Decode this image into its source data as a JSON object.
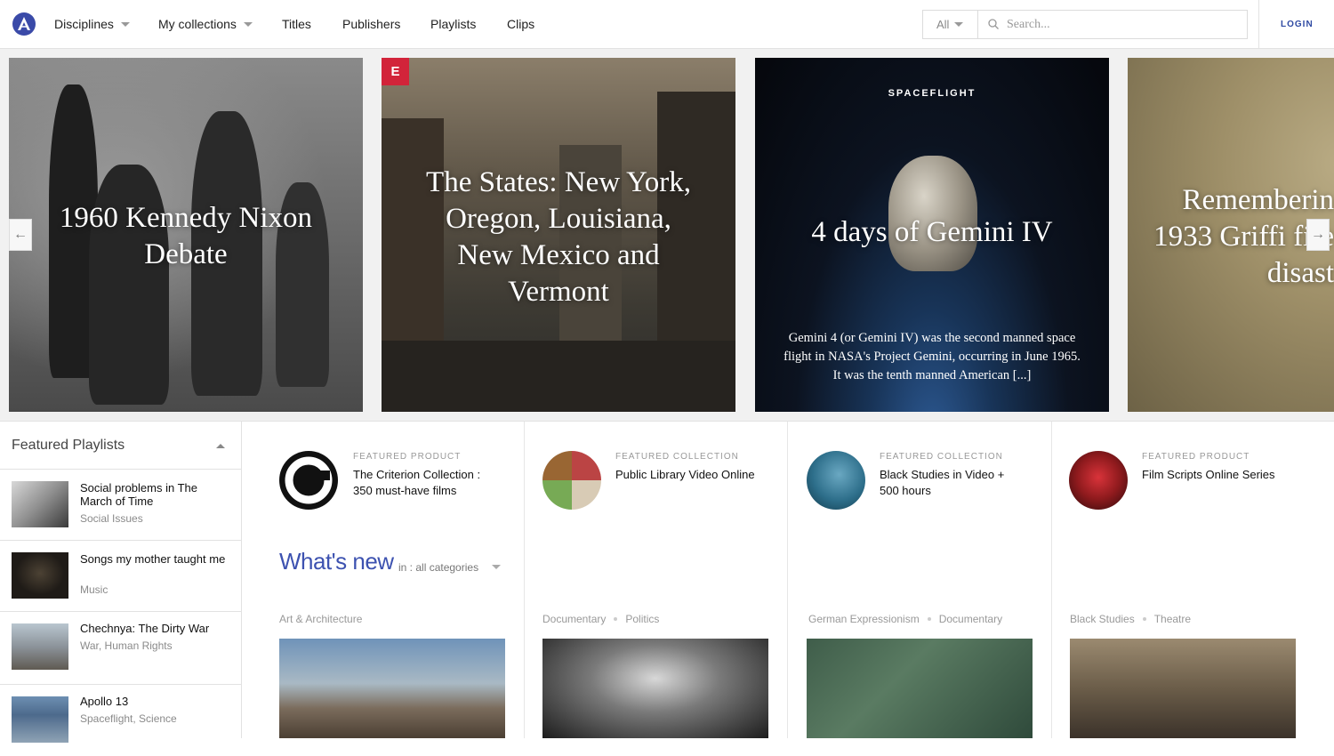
{
  "nav": {
    "items": [
      {
        "label": "Disciplines",
        "dropdown": true
      },
      {
        "label": "My collections",
        "dropdown": true
      },
      {
        "label": "Titles"
      },
      {
        "label": "Publishers"
      },
      {
        "label": "Playlists"
      },
      {
        "label": "Clips"
      }
    ],
    "search_scope": "All",
    "search_placeholder": "Search...",
    "login": "LOGIN",
    "accent": "#2f4aa3"
  },
  "hero": {
    "slides": [
      {
        "title": "1960 Kennedy Nixon Debate"
      },
      {
        "title": "The States: New York, Oregon, Louisiana, New Mexico and Vermont",
        "badge": "E",
        "badge_color": "#d2243a"
      },
      {
        "kicker": "SPACEFLIGHT",
        "title": "4 days of Gemini IV",
        "description": "Gemini 4 (or Gemini IV) was the second manned space flight in NASA's Project Gemini, occurring in June 1965. It was the tenth manned American [...]"
      },
      {
        "title": "Rememberin 1933 Griffi fire disast"
      }
    ],
    "prev_icon": "←",
    "next_icon": "→"
  },
  "sidebar": {
    "title": "Featured Playlists",
    "items": [
      {
        "title": "Social problems in The March of Time",
        "category": "Social Issues"
      },
      {
        "title": "Songs my mother taught me",
        "category": "Music"
      },
      {
        "title": "Chechnya: The Dirty War",
        "category": "War, Human Rights"
      },
      {
        "title": "Apollo 13",
        "category": "Spaceflight, Science"
      }
    ]
  },
  "featured": [
    {
      "kicker": "FEATURED PRODUCT",
      "title": "The Criterion Collection : 350 must-have films"
    },
    {
      "kicker": "FEATURED COLLECTION",
      "title": "Public Library Video Online"
    },
    {
      "kicker": "FEATURED COLLECTION",
      "title": "Black Studies in Video + 500 hours"
    },
    {
      "kicker": "FEATURED PRODUCT",
      "title": "Film Scripts Online Series"
    }
  ],
  "whats_new": {
    "title": "What's new",
    "filter_label": "in :",
    "filter_value": "all categories"
  },
  "cards": [
    {
      "tags": [
        "Art & Architecture"
      ]
    },
    {
      "tags": [
        "Documentary",
        "Politics"
      ]
    },
    {
      "tags": [
        "German Expressionism",
        "Documentary"
      ]
    },
    {
      "tags": [
        "Black Studies",
        "Theatre"
      ]
    }
  ]
}
